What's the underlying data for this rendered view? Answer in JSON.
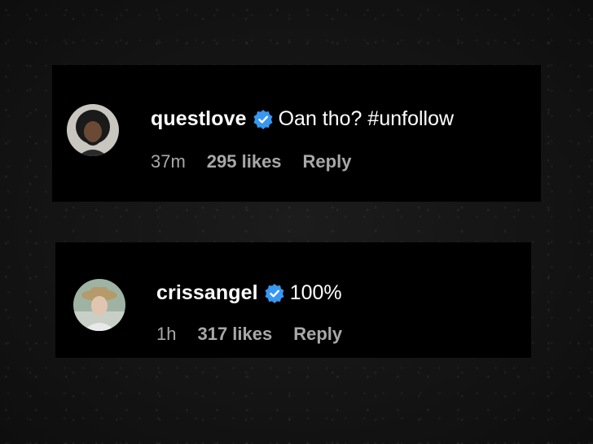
{
  "comments": [
    {
      "username": "questlove",
      "text": "Oan tho? #unfollow",
      "time": "37m",
      "likes": "295 likes",
      "reply": "Reply"
    },
    {
      "username": "crissangel",
      "text": "100%",
      "time": "1h",
      "likes": "317 likes",
      "reply": "Reply"
    }
  ],
  "colors": {
    "verified": "#3897f0",
    "meta": "#a8a8a8",
    "card": "#000000"
  }
}
